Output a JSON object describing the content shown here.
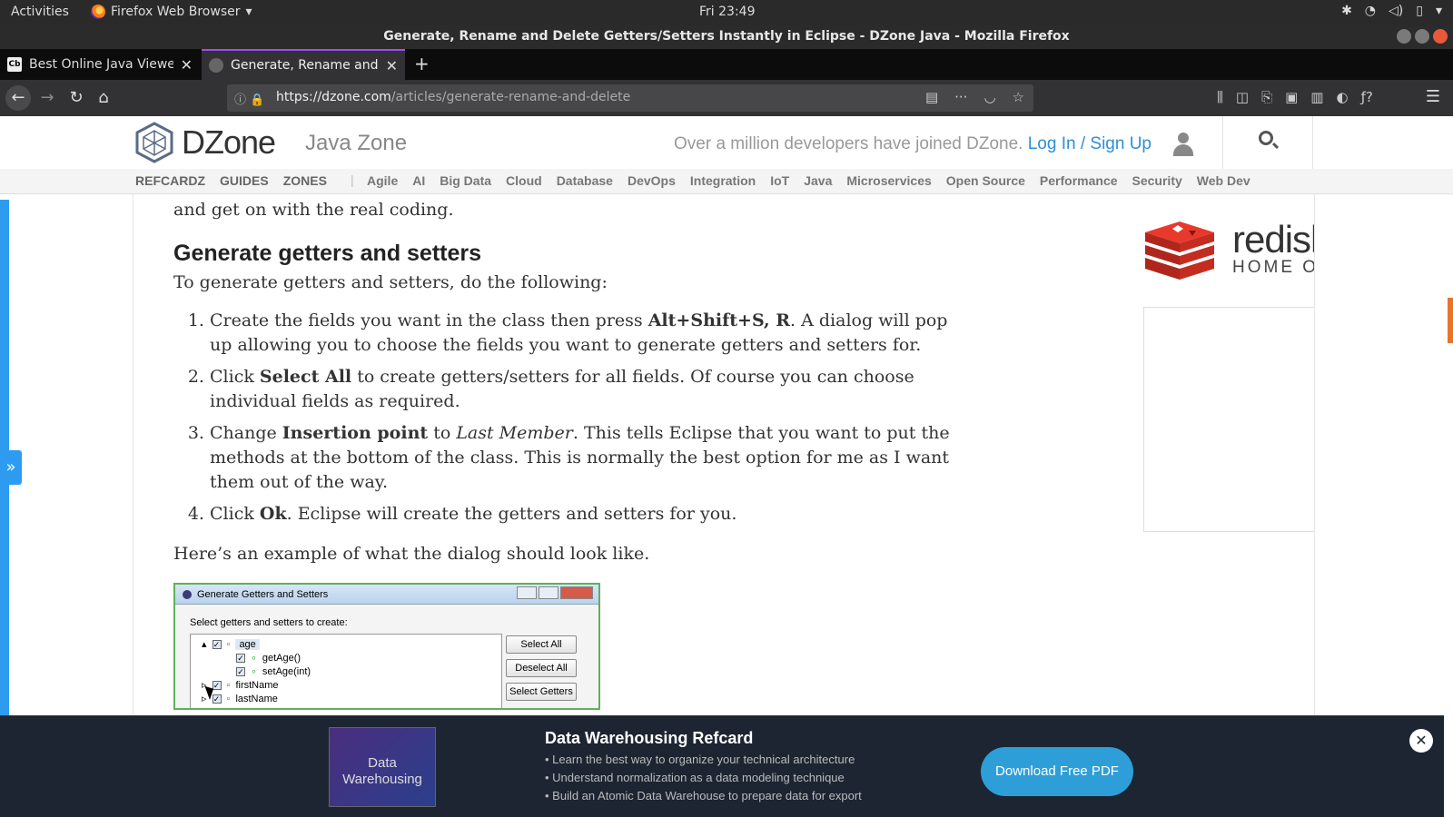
{
  "os_bar": {
    "activities": "Activities",
    "app_name": "Firefox Web Browser",
    "clock": "Fri 23:49"
  },
  "window": {
    "title": "Generate, Rename and Delete Getters/Setters Instantly in Eclipse - DZone Java - Mozilla Firefox"
  },
  "tabs": [
    {
      "label": "Best Online Java Viewer",
      "favicon": "Cb",
      "active": false
    },
    {
      "label": "Generate, Rename and D",
      "active": true
    }
  ],
  "url": {
    "domain": "https://dzone.com",
    "path": "/articles/generate-rename-and-delete"
  },
  "site": {
    "logo": "DZone",
    "zone": "Java Zone",
    "join_text": "Over a million developers have joined DZone.",
    "login": "Log In",
    "slash": "/",
    "signup": "Sign Up",
    "main_nav": [
      "REFCARDZ",
      "GUIDES",
      "ZONES"
    ],
    "zones": [
      "Agile",
      "AI",
      "Big Data",
      "Cloud",
      "Database",
      "DevOps",
      "Integration",
      "IoT",
      "Java",
      "Microservices",
      "Open Source",
      "Performance",
      "Security",
      "Web Dev"
    ]
  },
  "article": {
    "top_line": "and get on with the real coding.",
    "heading": "Generate getters and setters",
    "intro": "To generate getters and setters, do the following:",
    "steps": [
      {
        "pre": "Create the fields you want in the class then press ",
        "bold": "Alt+Shift+S, R",
        "post": ". A dialog will pop up allowing you to choose the fields you want to generate getters and setters for."
      },
      {
        "pre": "Click ",
        "bold": "Select All",
        "post": " to create getters/setters for all fields. Of course you can choose individual fields as required."
      },
      {
        "pre": "Change ",
        "bold": "Insertion point",
        "mid": " to ",
        "italic": "Last Member",
        "post": ". This tells Eclipse that you want to put the methods at the bottom of the class. This is normally the best option for me as I want them out of the way."
      },
      {
        "pre": "Click ",
        "bold": "Ok",
        "post": ". Eclipse will create the getters and setters for you."
      }
    ],
    "example": "Here’s an example of what the dialog should look like."
  },
  "dialog": {
    "title": "Generate Getters and Setters",
    "prompt": "Select getters and setters to create:",
    "tree": [
      "age",
      "getAge()",
      "setAge(int)",
      "firstName",
      "lastName"
    ],
    "buttons": [
      "Select All",
      "Deselect All",
      "Select Getters"
    ]
  },
  "sidebar": {
    "brand": "redislabs",
    "brand_tag": "HOME OF REDIS"
  },
  "banner": {
    "cover_line1": "Data",
    "cover_line2": "Warehousing",
    "title": "Data Warehousing Refcard",
    "bullets": [
      "• Learn the best way to organize your technical architecture",
      "• Understand normalization as a data modeling technique",
      "• Build an Atomic Data Warehouse to prepare data for export"
    ],
    "cta": "Download Free PDF",
    "close": "✕"
  },
  "colors": {
    "accent_blue": "#2d9cf0",
    "link": "#2d8fd5",
    "cta": "#2e9ed8",
    "redis_red": "#d82c20"
  }
}
